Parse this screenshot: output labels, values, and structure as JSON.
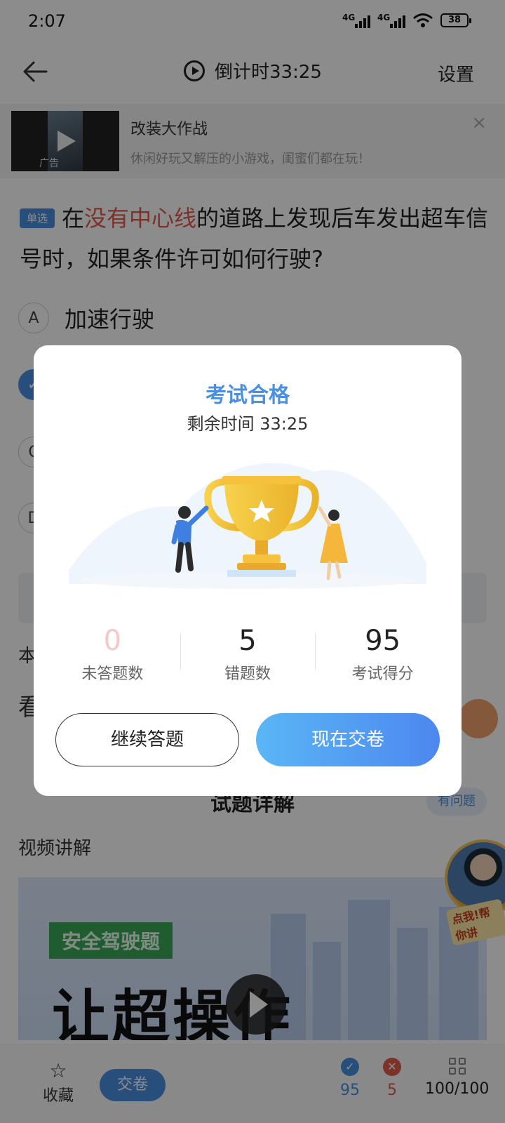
{
  "status_bar": {
    "time": "2:07",
    "net1": "4G",
    "net2": "4G",
    "battery": "38"
  },
  "top_bar": {
    "timer_label": "倒计时33:25",
    "settings_label": "设置"
  },
  "ad": {
    "title": "改装大作战",
    "description": "休闲好玩又解压的小游戏，闺蜜们都在玩！",
    "tag": "广告",
    "close": "×"
  },
  "question": {
    "type_badge": "单选",
    "text_before": "在",
    "text_highlight": "没有中心线",
    "text_after": "的道路上发现后车发出超车信号时，如果条件许可如何行驶?"
  },
  "options": [
    {
      "letter": "A",
      "text": "加速行驶"
    },
    {
      "letter": "✓",
      "text": ""
    },
    {
      "letter": "C",
      "text": ""
    },
    {
      "letter": "D",
      "text": ""
    }
  ],
  "page_bits": {
    "side1": "本",
    "side2": "看"
  },
  "detail": {
    "heading": "试题详解",
    "ask_label": "有问题",
    "video_label": "视频讲解",
    "avatar_tag": "点我!帮你讲"
  },
  "video": {
    "green_label": "安全驾驶题",
    "big_title": "让超操作"
  },
  "bottom_bar": {
    "favorite": "收藏",
    "submit": "交卷",
    "correct_count": "95",
    "wrong_count": "5",
    "progress": "100/100"
  },
  "modal": {
    "title": "考试合格",
    "subtitle": "剩余时间 33:25",
    "stats": [
      {
        "value": "0",
        "label": "未答题数"
      },
      {
        "value": "5",
        "label": "错题数"
      },
      {
        "value": "95",
        "label": "考试得分"
      }
    ],
    "continue_label": "继续答题",
    "submit_label": "现在交卷"
  },
  "colors": {
    "accent": "#4a90e2",
    "highlight_red": "#e25b4b",
    "gold": "#f6c23e"
  }
}
